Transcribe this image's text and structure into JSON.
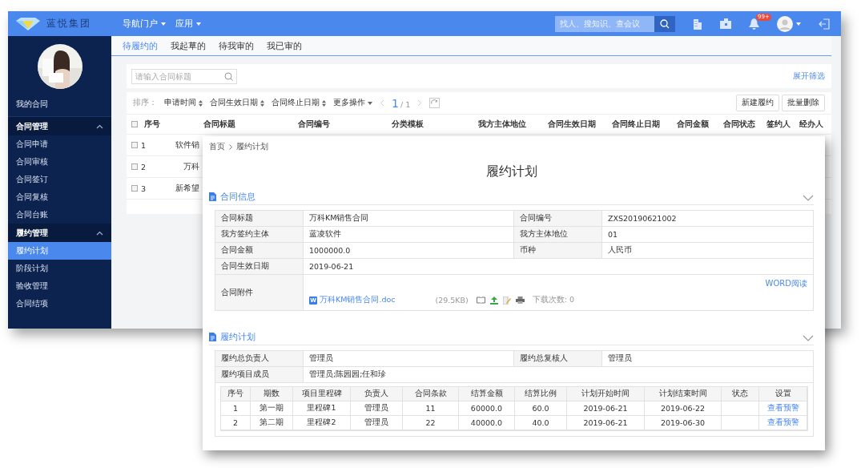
{
  "app_header": {
    "logo_text": "蓝悦集团",
    "nav": [
      {
        "label": "导航门户"
      },
      {
        "label": "应用"
      }
    ],
    "search_placeholder": "找人、搜知识、查会议",
    "notification_badge": "99+"
  },
  "sidebar": {
    "section_label": "我的合同",
    "groups": [
      {
        "label": "合同管理",
        "expanded": true,
        "children": [
          {
            "label": "合同申请",
            "selected": false
          },
          {
            "label": "合同审核",
            "selected": false
          },
          {
            "label": "合同签订",
            "selected": false
          },
          {
            "label": "合同复核",
            "selected": false
          },
          {
            "label": "合同台账",
            "selected": false
          }
        ]
      },
      {
        "label": "履约管理",
        "expanded": true,
        "children": [
          {
            "label": "履约计划",
            "selected": true
          },
          {
            "label": "阶段计划",
            "selected": false
          },
          {
            "label": "验收管理",
            "selected": false
          },
          {
            "label": "合同结项",
            "selected": false
          }
        ]
      }
    ]
  },
  "tabs": [
    {
      "label": "待履约的",
      "selected": true
    },
    {
      "label": "我起草的",
      "selected": false
    },
    {
      "label": "待我审的",
      "selected": false
    },
    {
      "label": "我已审的",
      "selected": false
    }
  ],
  "filter": {
    "search_placeholder": "请输入合同标题",
    "expand_link": "展开筛选"
  },
  "toolbar": {
    "sort_label": "排序：",
    "sort_options": [
      "申请时间",
      "合同生效日期",
      "合同终止日期"
    ],
    "more_actions": "更多操作",
    "page_current": "1",
    "page_total": "/ 1",
    "buttons": [
      "新建履约",
      "批量删除"
    ]
  },
  "contract_table": {
    "select_all_checked": false,
    "columns": [
      "序号",
      "合同标题",
      "合同编号",
      "分类模板",
      "我方主体地位",
      "合同生效日期",
      "合同终止日期",
      "合同金额",
      "合同状态",
      "签约人",
      "经办人"
    ],
    "rows": [
      {
        "checked": false,
        "index": "1",
        "title": "软件销"
      },
      {
        "checked": false,
        "index": "2",
        "title": "万科"
      },
      {
        "checked": false,
        "index": "3",
        "title": "新希望"
      }
    ]
  },
  "detail": {
    "breadcrumb": [
      "首页",
      "履约计划"
    ],
    "title": "履约计划",
    "contract_info": {
      "heading": "合同信息",
      "expanded": true,
      "field_rows": [
        [
          {
            "label": "合同标题",
            "value": "万科KM销售合同"
          },
          {
            "label": "合同编号",
            "value": "ZXS20190621002"
          }
        ],
        [
          {
            "label": "我方签约主体",
            "value": "蓝凌软件"
          },
          {
            "label": "我方主体地位",
            "value": "01"
          }
        ],
        [
          {
            "label": "合同金额",
            "value": "1000000.0"
          },
          {
            "label": "币种",
            "value": "人民币"
          }
        ],
        [
          {
            "label": "合同生效日期",
            "value": "2019-06-21"
          }
        ]
      ],
      "attachment": {
        "label": "合同附件",
        "file_badge": "W",
        "file_name": "万科KM销售合同.doc",
        "size": "(29.5KB)",
        "downloads": "下载次数: 0",
        "read_link": "WORD阅读"
      }
    },
    "plan": {
      "heading": "履约计划",
      "expanded": true,
      "field_rows": [
        [
          {
            "label": "履约总负责人",
            "value": "管理员"
          },
          {
            "label": "履约总复核人",
            "value": "管理员"
          }
        ],
        [
          {
            "label": "履约项目成员",
            "value": "管理员;陈园园;任和珍"
          }
        ]
      ],
      "columns": [
        "序号",
        "期数",
        "项目里程碑",
        "负责人",
        "合同条款",
        "结算金额",
        "结算比例",
        "计划开始时间",
        "计划结束时间",
        "状态",
        "设置"
      ],
      "items": [
        {
          "index": "1",
          "period": "第一期",
          "milestone": "里程碑1",
          "owner": "管理员",
          "clauses": "11",
          "amount": "60000.0",
          "ratio": "60.0",
          "start": "2019-06-21",
          "end": "2019-06-22",
          "action": "查看预警"
        },
        {
          "index": "2",
          "period": "第二期",
          "milestone": "里程碑2",
          "owner": "管理员",
          "clauses": "22",
          "amount": "40000.0",
          "ratio": "40.0",
          "start": "2019-06-21",
          "end": "2019-06-30",
          "action": "查看预警"
        }
      ]
    }
  }
}
